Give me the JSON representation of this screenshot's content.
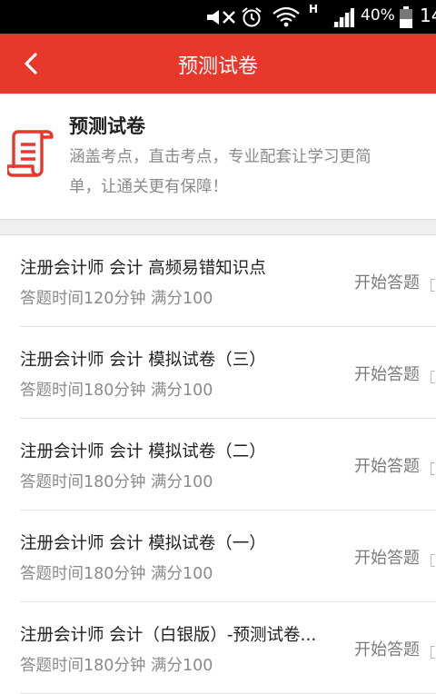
{
  "status_bar": {
    "network_label": "H",
    "battery_percent": "40%",
    "time": "14",
    "icons": [
      "mute-icon",
      "alarm-icon",
      "wifi-icon",
      "signal-icon",
      "battery-icon"
    ]
  },
  "header": {
    "title": "预测试卷",
    "back_icon": "chevron-left-icon",
    "background": "#e8372b"
  },
  "intro": {
    "icon": "scroll-document-icon",
    "title": "预测试卷",
    "description": "涵盖考点，直击考点，专业配套让学习更简单，让通关更有保障！"
  },
  "papers": [
    {
      "title": "注册会计师 会计 高频易错知识点",
      "meta": "答题时间120分钟 满分100",
      "action": "开始答题"
    },
    {
      "title": "注册会计师 会计 模拟试卷（三）",
      "meta": "答题时间180分钟 满分100",
      "action": "开始答题"
    },
    {
      "title": "注册会计师 会计 模拟试卷（二）",
      "meta": "答题时间180分钟 满分100",
      "action": "开始答题"
    },
    {
      "title": "注册会计师 会计 模拟试卷（一）",
      "meta": "答题时间180分钟 满分100",
      "action": "开始答题"
    },
    {
      "title": "注册会计师 会计（白银版）-预测试卷...",
      "meta": "答题时间180分钟 满分100",
      "action": "开始答题"
    }
  ]
}
